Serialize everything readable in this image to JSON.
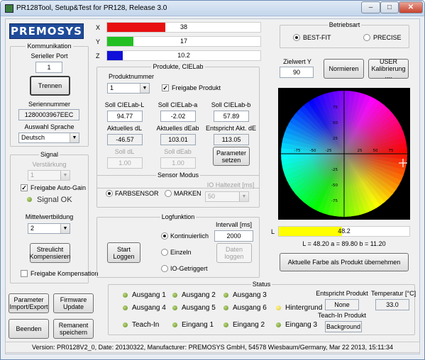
{
  "window": {
    "title": "PR128Tool, Setup&Test for PR128, Release 3.0"
  },
  "logo": "PREMOSYS",
  "xyz": [
    {
      "axis": "X",
      "value": "38",
      "fraction": 0.38,
      "color": "#e81010"
    },
    {
      "axis": "Y",
      "value": "17",
      "fraction": 0.17,
      "color": "#22c022"
    },
    {
      "axis": "Z",
      "value": "10.2",
      "fraction": 0.102,
      "color": "#1010d8"
    }
  ],
  "kommunikation": {
    "title": "Kommunikation",
    "port_label": "Serieller Port",
    "port_value": "1",
    "disconnect_btn": "Trennen",
    "serial_label": "Seriennummer",
    "serial_value": "1280003967EEC",
    "lang_label": "Auswahl Sprache",
    "lang_value": "Deutsch"
  },
  "signal": {
    "title": "Signal",
    "gain_label": "Verstärkung",
    "gain_value": "1",
    "autogain_label": "Freigabe Auto-Gain",
    "status_text": "Signal OK",
    "avg_label": "Mittelwertbildung",
    "avg_value": "2",
    "straylight_btn": "Streulicht Kompensieren",
    "comp_label": "Freigabe Kompensation"
  },
  "buttons_left": {
    "param": "Parameter Import/Export",
    "firmware": "Firmware Update",
    "exit": "Beenden",
    "remanent": "Remanent speichern"
  },
  "produkte": {
    "title": "Produkte, CIELab",
    "prodnum_label": "Produktnummer",
    "prodnum_value": "1",
    "release_label": "Freigabe Produkt",
    "soll_l_label": "Soll CIELab-L",
    "soll_l_value": "94.77",
    "soll_a_label": "Soll CIELab-a",
    "soll_a_value": "-2.02",
    "soll_b_label": "Soll CIELab-b",
    "soll_b_value": "57.89",
    "akt_dl_label": "Aktuelles dL",
    "akt_dl_value": "-46.57",
    "akt_deab_label": "Aktuelles dEab",
    "akt_deab_value": "103.01",
    "entspr_label": "Entspricht Akt. dE",
    "entspr_value": "113.05",
    "soll_dl_label": "Soll dL",
    "soll_dl_value": "1.00",
    "soll_deab_label": "Soll dEab",
    "soll_deab_value": "1.00",
    "param_btn": "Parameter setzen"
  },
  "sensor": {
    "title": "Sensor Modus",
    "opt1": "FARBSENSOR",
    "opt2": "MARKEN",
    "hold_label": "IO Haltezeit [ms]",
    "hold_value": "50"
  },
  "log": {
    "title": "Logfunktion",
    "start_btn": "Start Loggen",
    "opt1": "Kontinuierlich",
    "opt2": "Einzeln",
    "opt3": "IO-Getriggert",
    "interval_label": "Intervall [ms]",
    "interval_value": "2000",
    "data_btn": "Daten loggen"
  },
  "betriebsart": {
    "title": "Betriebsart",
    "opt1": "BEST-FIT",
    "opt2": "PRECISE"
  },
  "zielwert": {
    "label": "Zielwert Y",
    "value": "90",
    "norm_btn": "Normieren",
    "user_btn": "USER Kalibrierung ...."
  },
  "colorwheel": {
    "ticks_y": [
      "75",
      "50",
      "25",
      "-25",
      "-50",
      "-75"
    ],
    "ticks_x": [
      "-75",
      "-50",
      "-25",
      "25",
      "50",
      "75"
    ]
  },
  "lbar": {
    "label": "L",
    "value": "48.2",
    "fraction": 0.482,
    "color": "#ffff00"
  },
  "lab_readout": "L = 48.20   a = 89.80   b = 11.20",
  "apply_btn": "Aktuelle Farbe als Produkt übernehmen",
  "status": {
    "title": "Status",
    "items": [
      {
        "label": "Ausgang 1",
        "led": "green"
      },
      {
        "label": "Ausgang 2",
        "led": "green"
      },
      {
        "label": "Ausgang 3",
        "led": "green"
      },
      {
        "label": "Ausgang 4",
        "led": "green"
      },
      {
        "label": "Ausgang 5",
        "led": "green"
      },
      {
        "label": "Ausgang 6",
        "led": "green"
      },
      {
        "label": "Hintergrund",
        "led": "yellow"
      },
      {
        "label": "Teach-In",
        "led": "green"
      },
      {
        "label": "Eingang 1",
        "led": "green"
      },
      {
        "label": "Eingang 2",
        "led": "green"
      },
      {
        "label": "Eingang 3",
        "led": "green"
      }
    ],
    "entspr_label": "Entspricht Produkt",
    "entspr_value": "None",
    "temp_label": "Temperatur [°C]",
    "temp_value": "33.0",
    "teachin_label": "Teach-In Produkt",
    "teachin_value": "Background"
  },
  "statusbar": "Version: PR0128V2_0, Date: 20130322, Manufacturer: PREMOSYS GmbH, 54578 Wiesbaum/Germany, Mar 22 2013, 15:11:34",
  "colors": {
    "accent": "#1f4b9a",
    "green_led": "#7aa43a",
    "yellow_led": "#e0d640",
    "cross": "#000000"
  }
}
